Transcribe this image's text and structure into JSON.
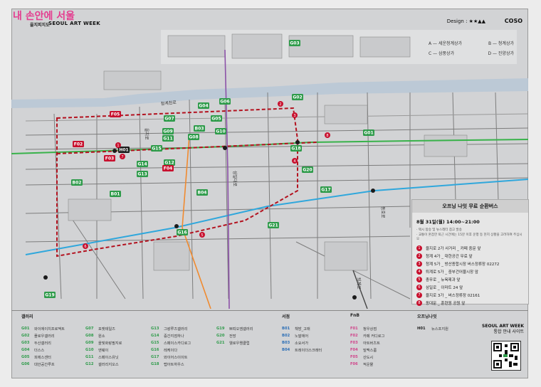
{
  "watermark": "내 손안에 서울",
  "header": {
    "small": "을지피지도",
    "title": "SEOUL ART WEEK",
    "design": "Design : ★★▲▲",
    "logo": "COSO"
  },
  "map_legend": [
    {
      "left": "A — 세운청계상가",
      "right": "B — 청계상가"
    },
    {
      "left": "C — 삼풍상가",
      "right": "D — 진양상가"
    }
  ],
  "street_labels": {
    "eulji": "을지로",
    "cheonggye": "청계천로",
    "toegye": "퇴계로",
    "samil": "삼일대로",
    "dongho": "동호로"
  },
  "markers": [
    {
      "code": "G03",
      "color": "green"
    },
    {
      "code": "G02",
      "color": "green"
    },
    {
      "code": "G04",
      "color": "green"
    },
    {
      "code": "G06",
      "color": "green"
    },
    {
      "code": "G05",
      "color": "green"
    },
    {
      "code": "G07",
      "color": "green"
    },
    {
      "code": "G09",
      "color": "green"
    },
    {
      "code": "G11",
      "color": "green"
    },
    {
      "code": "B03",
      "color": "green"
    },
    {
      "code": "G10",
      "color": "green"
    },
    {
      "code": "G08",
      "color": "green"
    },
    {
      "code": "G01",
      "color": "green"
    },
    {
      "code": "G15",
      "color": "green"
    },
    {
      "code": "G12",
      "color": "green"
    },
    {
      "code": "G14",
      "color": "green"
    },
    {
      "code": "G13",
      "color": "green"
    },
    {
      "code": "G18",
      "color": "green"
    },
    {
      "code": "G20",
      "color": "green"
    },
    {
      "code": "G17",
      "color": "green"
    },
    {
      "code": "B02",
      "color": "green"
    },
    {
      "code": "B01",
      "color": "green"
    },
    {
      "code": "B04",
      "color": "green"
    },
    {
      "code": "G16",
      "color": "green"
    },
    {
      "code": "G21",
      "color": "green"
    },
    {
      "code": "G19",
      "color": "green"
    },
    {
      "code": "F05",
      "color": "red"
    },
    {
      "code": "F02",
      "color": "red"
    },
    {
      "code": "F03",
      "color": "red"
    },
    {
      "code": "F04",
      "color": "red"
    },
    {
      "code": "H01",
      "color": "dark"
    }
  ],
  "info_box": {
    "title": "오프닝 나잇 무료 순환버스",
    "time": "8월 31일(월) 14:00~21:00",
    "notes": [
      "· 택시 탑승 및 뉴스레터 참고 발송",
      "· 교통이 혼잡한 퇴근 시간에는 15분 이후 운행 등 현지 상황을 고려하여 주십시오"
    ],
    "stops": [
      {
        "n": "1",
        "text": "을지로 2가 사거리 _ 카페 중문 앞"
      },
      {
        "n": "2",
        "text": "청계 4가 _ 대한공간 무료 앞"
      },
      {
        "n": "3",
        "text": "청계 5가 _ 방산종합시장 버스정류장 02272"
      },
      {
        "n": "4",
        "text": "퇴계로 5가 _ 중부건어물시장 앞"
      },
      {
        "n": "5",
        "text": "충무로 _ 뉴욕제과 앞"
      },
      {
        "n": "6",
        "text": "삼일로 _ 이마트 24 앞"
      },
      {
        "n": "7",
        "text": "을지로 3가 _ 버스정류장 02161"
      },
      {
        "n": "8",
        "text": "동대문 _ 훈련원 공원 앞"
      }
    ]
  },
  "bottom": {
    "categories": [
      "갤러리",
      "서점",
      "FnB",
      "오프닝나잇"
    ],
    "gallery_col1": [
      {
        "c": "G01",
        "t": "와이에이치프로젝트"
      },
      {
        "c": "G02",
        "t": "플로우갤러리"
      },
      {
        "c": "G03",
        "t": "두산갤러리"
      },
      {
        "c": "G04",
        "t": "더스스"
      },
      {
        "c": "G05",
        "t": "피에스센터"
      },
      {
        "c": "G06",
        "t": "대안공간루프"
      }
    ],
    "gallery_col2": [
      {
        "c": "G07",
        "t": "포켓테일즈"
      },
      {
        "c": "G08",
        "t": "원소"
      },
      {
        "c": "G09",
        "t": "을빛화랑필지로"
      },
      {
        "c": "G10",
        "t": "엔웨이"
      },
      {
        "c": "G11",
        "t": "스페이스유닛"
      },
      {
        "c": "G12",
        "t": "갤러리지오스"
      }
    ],
    "gallery_col3": [
      {
        "c": "G13",
        "t": "그랑루즈갤러리"
      },
      {
        "c": "G14",
        "t": "중간지점하나"
      },
      {
        "c": "G15",
        "t": "스페이스카디로그"
      },
      {
        "c": "G16",
        "t": "레케이다"
      },
      {
        "c": "G17",
        "t": "와이어스이이트"
      },
      {
        "c": "G18",
        "t": "랩아트하우스"
      }
    ],
    "gallery_col4": [
      {
        "c": "G19",
        "t": "쁘띠오엠갤러리"
      },
      {
        "c": "G20",
        "t": "전망"
      },
      {
        "c": "G21",
        "t": "웰로우웬클럽"
      }
    ],
    "books": [
      {
        "c": "B01",
        "t": "책방_고래"
      },
      {
        "c": "B02",
        "t": "노말에어"
      },
      {
        "c": "B03",
        "t": "소요서가"
      },
      {
        "c": "B04",
        "t": "트레이더스크래터"
      }
    ],
    "fnb": [
      {
        "c": "F01",
        "t": "청우상점"
      },
      {
        "c": "F02",
        "t": "카페 커디로그"
      },
      {
        "c": "F03",
        "t": "아트버츠트"
      },
      {
        "c": "F04",
        "t": "밀맥스룸"
      },
      {
        "c": "F05",
        "t": "산도시"
      },
      {
        "c": "F06",
        "t": "적운물"
      }
    ],
    "opening": [
      {
        "c": "H01",
        "t": "뉴스프지원"
      }
    ],
    "side_title": "SEOUL ART WEEK",
    "side_sub": "통합 안내 사이트"
  },
  "colors": {
    "green": "#2e9b4a",
    "red": "#c8102e",
    "dark": "#1b1b1b",
    "route": "#b3121f"
  }
}
